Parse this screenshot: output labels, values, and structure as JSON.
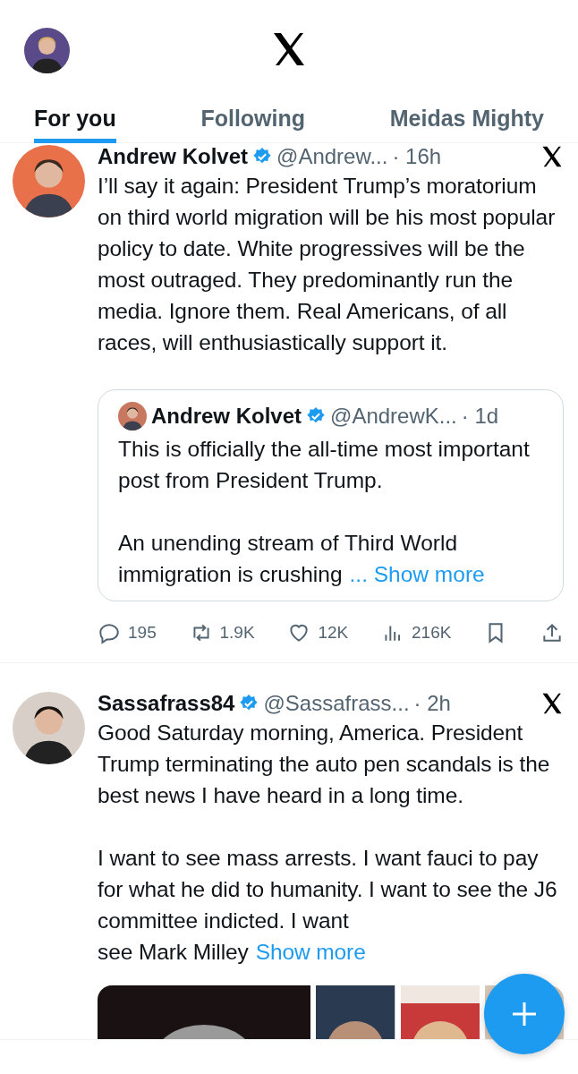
{
  "tabs": [
    {
      "label": "For you",
      "selected": true
    },
    {
      "label": "Following",
      "selected": false
    },
    {
      "label": "Meidas Mighty",
      "selected": false
    }
  ],
  "posts": [
    {
      "name": "Andrew Kolvet",
      "verified": true,
      "handle": "@Andrew...",
      "time": "· 16h",
      "paragraphs": [
        "I’ll say it again: President Trump’s moratorium on third world migration will be his most popular policy to date. White progressives will be the most outraged. They predominantly run the media. Ignore them. Real Americans, of all races, will enthusiastically support it."
      ],
      "quote": {
        "name": "Andrew Kolvet",
        "verified": true,
        "handle": "@AndrewK...",
        "time": "· 1d",
        "paragraphs": [
          "This is officially the all-time most important post from President Trump.",
          "An unending stream of Third World"
        ],
        "tail": "immigration is crushing",
        "more": "... Show more"
      },
      "actions": [
        {
          "kind": "reply",
          "count": "195"
        },
        {
          "kind": "repost",
          "count": "1.9K"
        },
        {
          "kind": "like",
          "count": "12K"
        },
        {
          "kind": "views",
          "count": "216K"
        },
        {
          "kind": "bookmark"
        },
        {
          "kind": "share"
        }
      ]
    },
    {
      "name": "Sassafrass84",
      "verified": true,
      "handle": "@Sassafrass...",
      "time": "· 2h",
      "paragraphs": [
        "Good Saturday morning, America. President Trump terminating the auto pen scandals is the best news I have heard in a long time.",
        "I want to see mass arrests. I want fauci to pay for what he did to humanity. I want to see the J6 committee indicted. I want"
      ],
      "tail": "see Mark Milley",
      "more": "Show more",
      "media": [
        {
          "kind": "picture"
        },
        {
          "kind": "picture"
        },
        {
          "kind": "picture"
        },
        {
          "kind": "picture"
        }
      ]
    }
  ]
}
